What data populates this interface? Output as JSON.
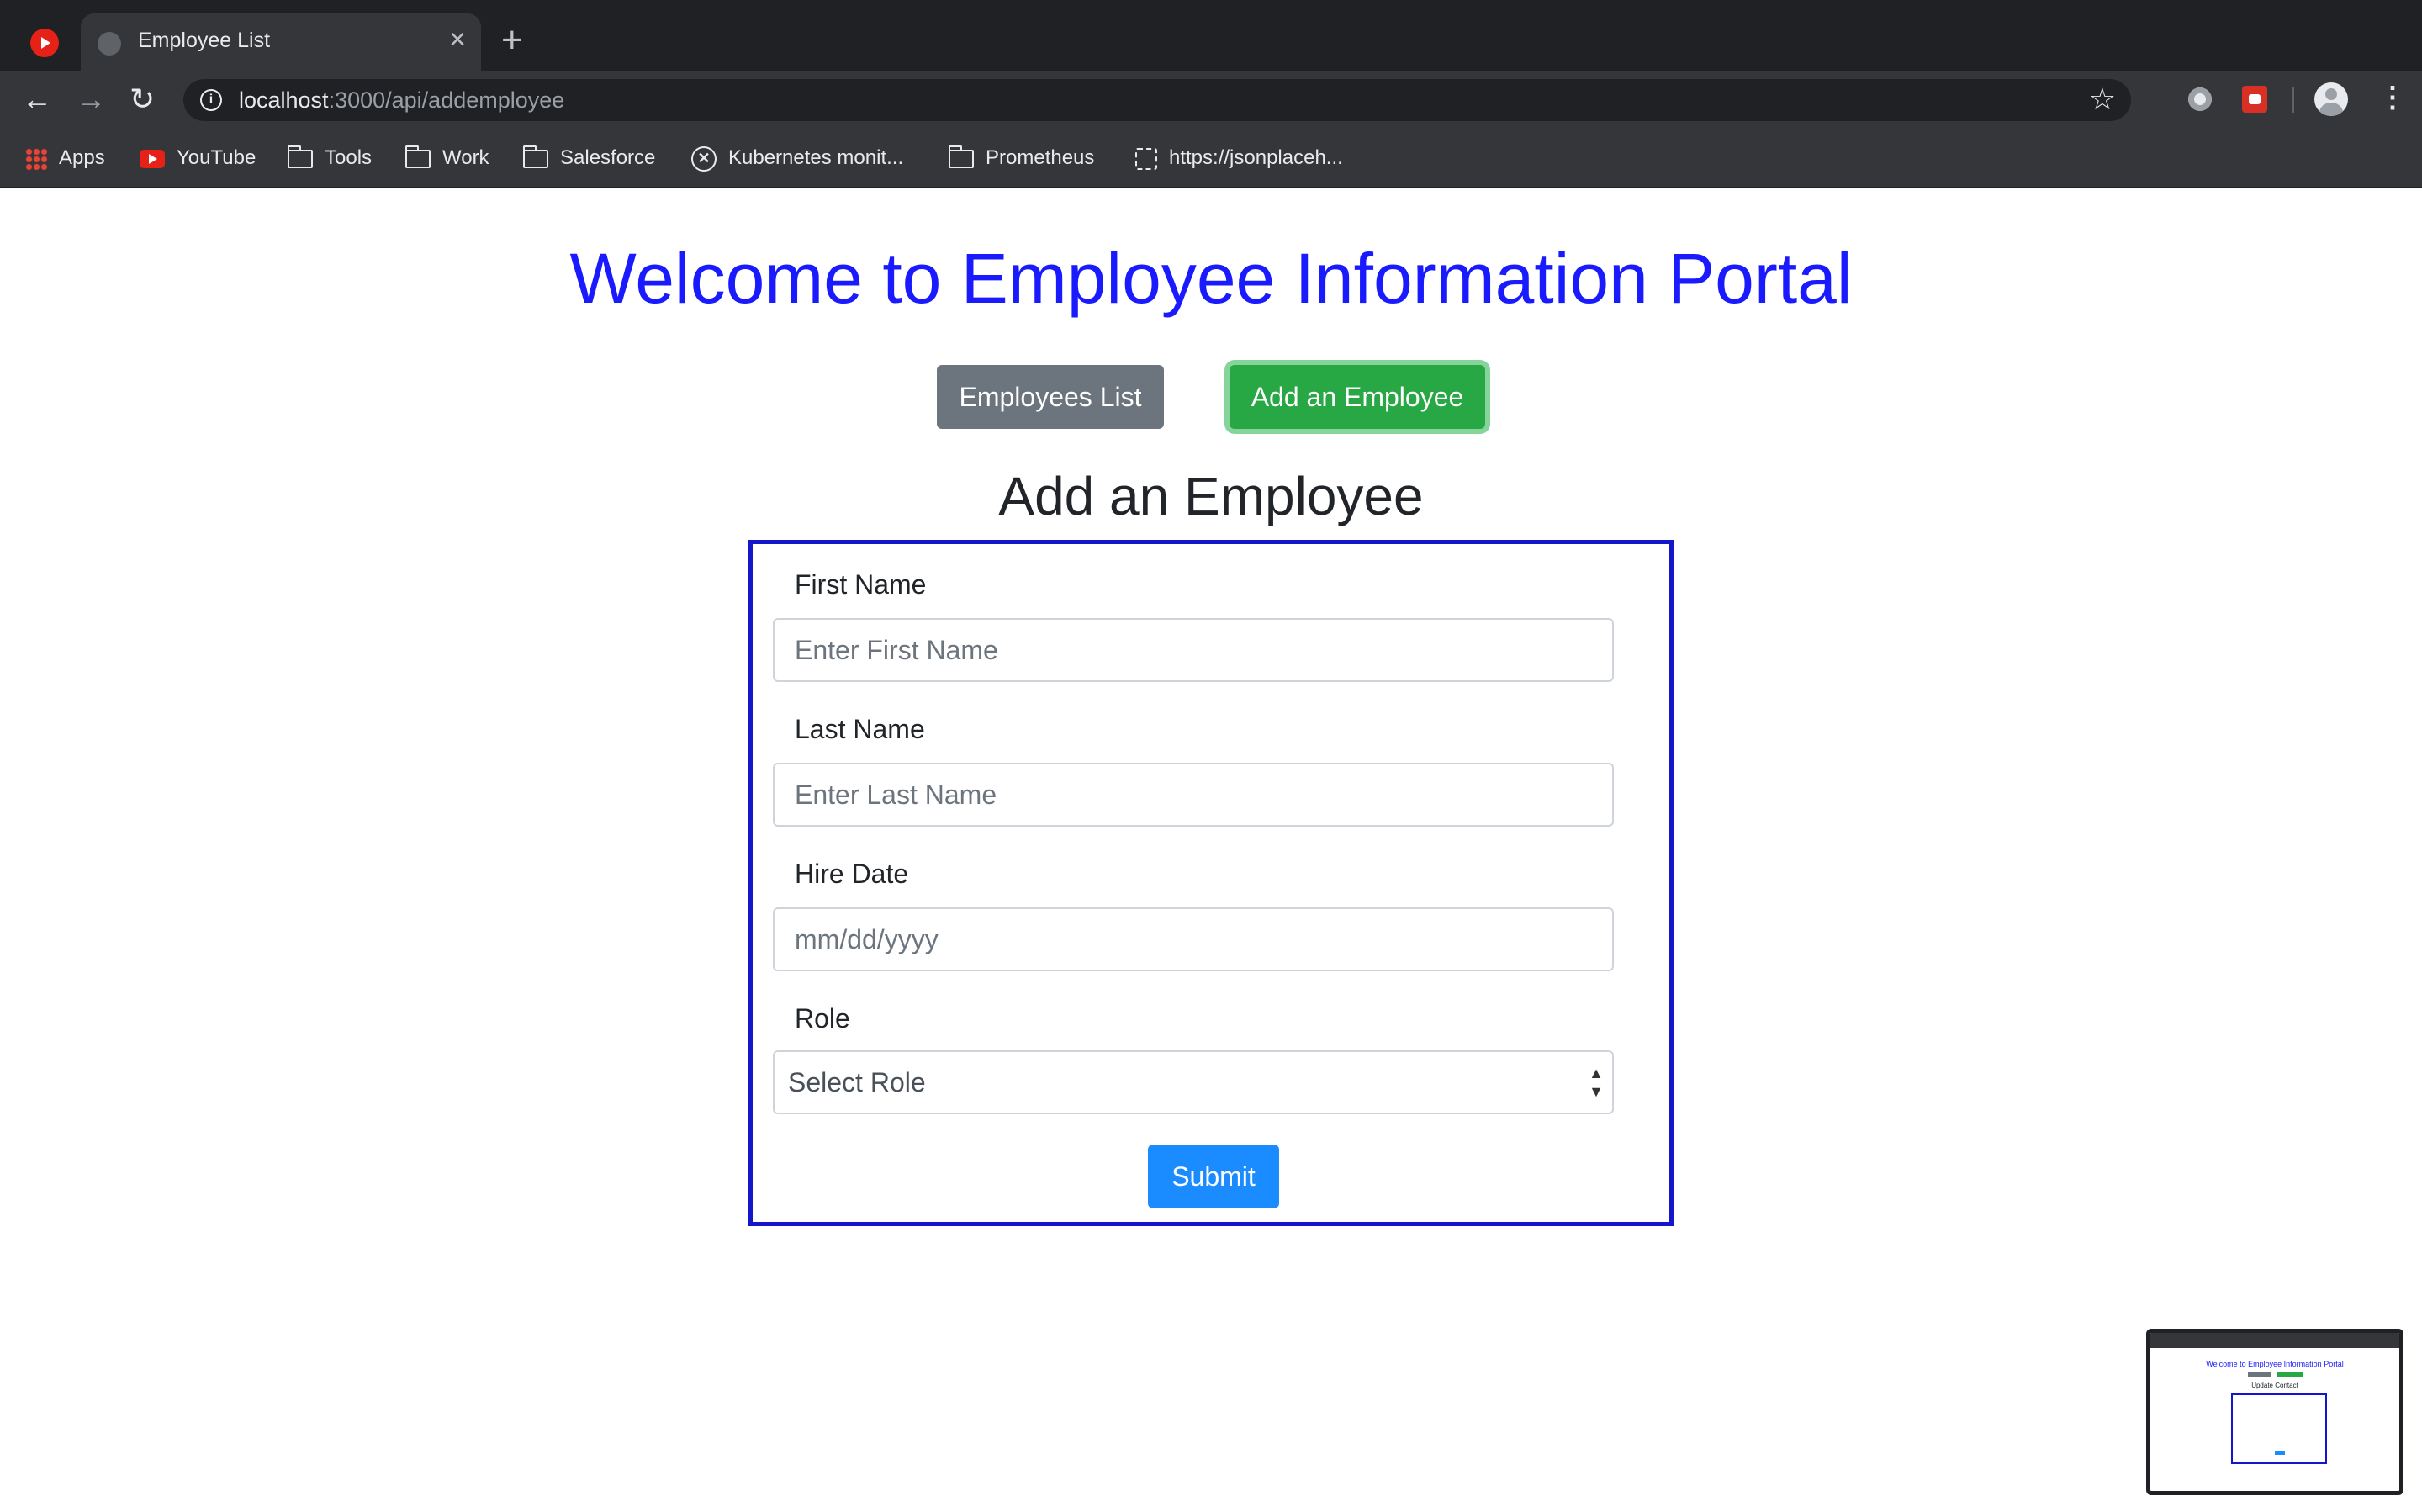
{
  "browser": {
    "tab_title": "Employee List",
    "url_host": "localhost",
    "url_path": ":3000/api/addemployee",
    "bookmarks": [
      "Apps",
      "YouTube",
      "Tools",
      "Work",
      "Salesforce",
      "Kubernetes monit...",
      "Prometheus",
      "https://jsonplaceh..."
    ]
  },
  "page": {
    "title": "Welcome to Employee Information Portal",
    "nav": {
      "employees_list": "Employees List",
      "add_employee": "Add an Employee"
    },
    "section_title": "Add an Employee",
    "form": {
      "first_name": {
        "label": "First Name",
        "placeholder": "Enter First Name"
      },
      "last_name": {
        "label": "Last Name",
        "placeholder": "Enter Last Name"
      },
      "hire_date": {
        "label": "Hire Date",
        "placeholder": "mm/dd/yyyy"
      },
      "role": {
        "label": "Role",
        "selected": "Select Role"
      },
      "submit": "Submit"
    }
  },
  "thumbnail": {
    "title": "Welcome to Employee Information Portal",
    "section_title": "Update Contact"
  },
  "colors": {
    "title": "#1a1aff",
    "secondary_button": "#6c757d",
    "success_button": "#28a745",
    "primary_button": "#1a8cff",
    "form_border": "#1515cc"
  }
}
